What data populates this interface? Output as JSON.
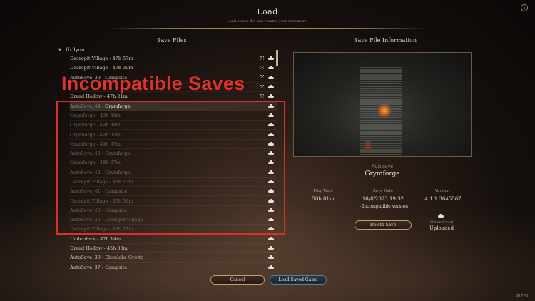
{
  "header": {
    "title": "Load",
    "subtitle": "Load a save file and resume your adventure."
  },
  "left_panel": {
    "title": "Save Files",
    "profile_name": "Urilynn",
    "saves": [
      {
        "name": "Decrepit Village - 47h 57m",
        "loc": "",
        "state": "normal",
        "icons": [
          "move",
          "cloud"
        ]
      },
      {
        "name": "Decrepit Village - 47h 39m",
        "loc": "",
        "state": "normal",
        "icons": [
          "move",
          "cloud"
        ]
      },
      {
        "name": "AutoSave_39 - ",
        "loc": "Campsite",
        "state": "normal",
        "icons": [
          "move",
          "cloud"
        ]
      },
      {
        "name": "",
        "loc": "",
        "state": "normal",
        "icons": [
          "move",
          "cloud"
        ]
      },
      {
        "name": "Dread Hollow - 47h 21m",
        "loc": "",
        "state": "normal",
        "icons": [
          "move",
          "cloud"
        ]
      },
      {
        "name": "AutoSave_44 - ",
        "loc": "Grymforge",
        "state": "selected",
        "icons": [
          "cloud"
        ]
      },
      {
        "name": "Grymforge - 49h 59m",
        "loc": "",
        "state": "incompat",
        "icons": [
          "cloud"
        ]
      },
      {
        "name": "Grymforge - 49h 38m",
        "loc": "",
        "state": "incompat",
        "icons": [
          "cloud"
        ]
      },
      {
        "name": "Grymforge - 49h 02m",
        "loc": "",
        "state": "incompat",
        "icons": [
          "cloud"
        ]
      },
      {
        "name": "Grymforge - 49h 07m",
        "loc": "",
        "state": "incompat",
        "icons": [
          "cloud"
        ]
      },
      {
        "name": "AutoSave_43 - ",
        "loc": "Grymforge",
        "state": "incompat",
        "icons": [
          "cloud"
        ]
      },
      {
        "name": "Grymforge - 48h 27m",
        "loc": "",
        "state": "incompat",
        "icons": [
          "cloud"
        ]
      },
      {
        "name": "AutoSave_42 - ",
        "loc": "Grymforge",
        "state": "incompat",
        "icons": [
          "cloud"
        ]
      },
      {
        "name": "Decrepit Village - 48h 13m",
        "loc": "",
        "state": "incompat",
        "icons": [
          "cloud"
        ]
      },
      {
        "name": "AutoSave_41 - ",
        "loc": "Campsite",
        "state": "incompat",
        "icons": [
          "cloud"
        ]
      },
      {
        "name": "Decrepit Village - 47h 59m",
        "loc": "",
        "state": "incompat",
        "icons": [
          "cloud"
        ]
      },
      {
        "name": "AutoSave_40 - ",
        "loc": "Campsite",
        "state": "incompat",
        "icons": [
          "cloud"
        ]
      },
      {
        "name": "AutoSave_39 - ",
        "loc": "Decrepit Village",
        "state": "incompat",
        "icons": [
          "cloud"
        ]
      },
      {
        "name": "Decrepit Village - 47h 27m",
        "loc": "",
        "state": "incompat",
        "icons": [
          "cloud"
        ]
      },
      {
        "name": "Underdark - 47h 14m",
        "loc": "",
        "state": "normal",
        "icons": [
          "cloud"
        ]
      },
      {
        "name": "Dread Hollow - 45h 08m",
        "loc": "",
        "state": "normal",
        "icons": [
          "cloud"
        ]
      },
      {
        "name": "AutoSave_38 - ",
        "loc": "Ebonlake Grotto",
        "state": "normal",
        "icons": [
          "cloud"
        ]
      },
      {
        "name": "AutoSave_37 - ",
        "loc": "Campsite",
        "state": "normal",
        "icons": [
          "cloud"
        ]
      }
    ]
  },
  "overlay": {
    "caption": "Incompatible Saves",
    "color": "#e0322c"
  },
  "right_panel": {
    "title": "Save File Information",
    "save_type": "Autosave",
    "location": "Grymforge",
    "play_time_label": "Play Time",
    "play_time": "50h 01m",
    "save_date_label": "Save Date",
    "save_date": "16/8/2023 19:32",
    "version_label": "Version",
    "version": "4.1.1.3645567",
    "incompatible_note": "- Incompatible version",
    "delete_button": "Delete Save",
    "steam_cloud_label": "Steam Cloud",
    "steam_cloud_status": "Uploaded"
  },
  "footer": {
    "cancel_button": "Cancel",
    "load_button": "Load Saved Game",
    "fps": "30 FPS"
  }
}
